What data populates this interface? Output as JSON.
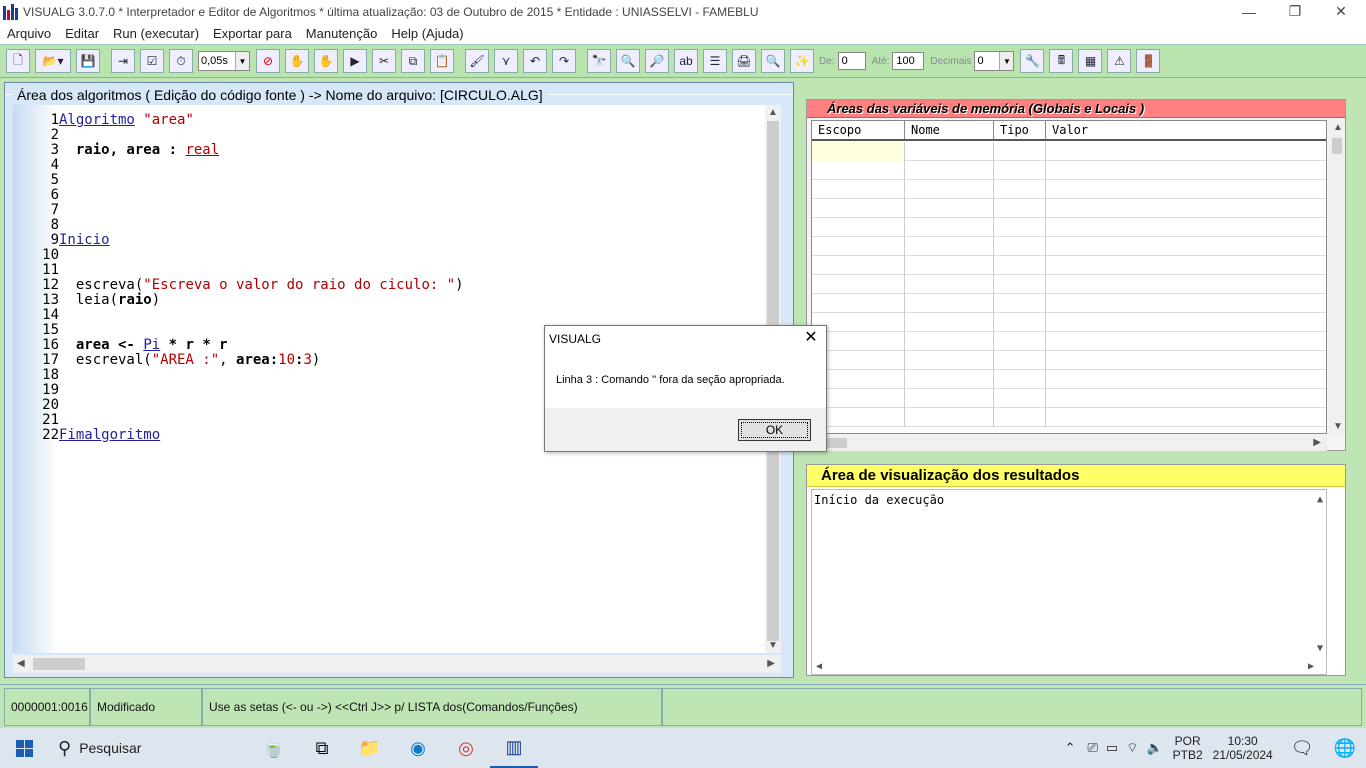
{
  "window": {
    "title": "VISUALG 3.0.7.0 * Interpretador e Editor de Algoritmos * última atualização: 03 de Outubro de 2015 * Entidade : UNIASSELVI - FAMEBLU"
  },
  "menu": [
    "Arquivo",
    "Editar",
    "Run (executar)",
    "Exportar para",
    "Manutenção",
    "Help (Ajuda)"
  ],
  "toolbar": {
    "speed": "0,05s",
    "de_label": "De:",
    "de_value": "0",
    "ate_label": "Até:",
    "ate_value": "100",
    "decimais_label": "Decimais",
    "decimais_value": "0"
  },
  "editor": {
    "header": "Área dos algoritmos ( Edição do código fonte ) -> Nome do arquivo: [CIRCULO.ALG]",
    "lines": [
      {
        "n": "1",
        "html": "<span class='kw'>Algoritmo</span> <span class='str'>\"area\"</span>"
      },
      {
        "n": "2",
        "html": ""
      },
      {
        "n": "3",
        "html": "  <span class='bold'>raio, area :</span> <span class='typ'>real</span>"
      },
      {
        "n": "4",
        "html": ""
      },
      {
        "n": "5",
        "html": ""
      },
      {
        "n": "6",
        "html": ""
      },
      {
        "n": "7",
        "html": ""
      },
      {
        "n": "8",
        "html": ""
      },
      {
        "n": "9",
        "html": "<span class='kw'>Inicio</span>"
      },
      {
        "n": "10",
        "html": ""
      },
      {
        "n": "11",
        "html": ""
      },
      {
        "n": "12",
        "html": "  escreva(<span class='str'>\"Escreva o valor do raio do ciculo: \"</span>)"
      },
      {
        "n": "13",
        "html": "  leia(<span class='bold'>raio</span>)"
      },
      {
        "n": "14",
        "html": ""
      },
      {
        "n": "15",
        "html": ""
      },
      {
        "n": "16",
        "html": "  <span class='bold'>area &lt;-</span> <span class='kw'>Pi</span> <span class='bold'>* r * r</span>"
      },
      {
        "n": "17",
        "html": "  escreval(<span class='str'>\"AREA :\"</span>, <span class='bold'>area:</span><span class='num'>10</span><span class='bold'>:</span><span class='num'>3</span>)"
      },
      {
        "n": "18",
        "html": ""
      },
      {
        "n": "19",
        "html": ""
      },
      {
        "n": "20",
        "html": ""
      },
      {
        "n": "21",
        "html": ""
      },
      {
        "n": "22",
        "html": "<span class='kw'>Fimalgoritmo</span>"
      }
    ]
  },
  "variables": {
    "header": "Áreas das variáveis de memória (Globais e Locais )",
    "columns": [
      "Escopo",
      "Nome",
      "Tipo",
      "Valor"
    ]
  },
  "results": {
    "header": "Área de visualização dos resultados",
    "text": "Início da execução"
  },
  "status": {
    "position": "0000001:0016",
    "state": "Modificado",
    "hint": "Use as setas (<- ou ->) <<Ctrl J>> p/ LISTA dos(Comandos/Funções)"
  },
  "dialog": {
    "title": "VISUALG",
    "message": "Linha 3 : Comando '' fora da seção apropriada.",
    "ok_label": "OK"
  },
  "taskbar": {
    "search_label": "Pesquisar",
    "lang_line1": "POR",
    "lang_line2": "PTB2",
    "time": "10:30",
    "date": "21/05/2024"
  }
}
